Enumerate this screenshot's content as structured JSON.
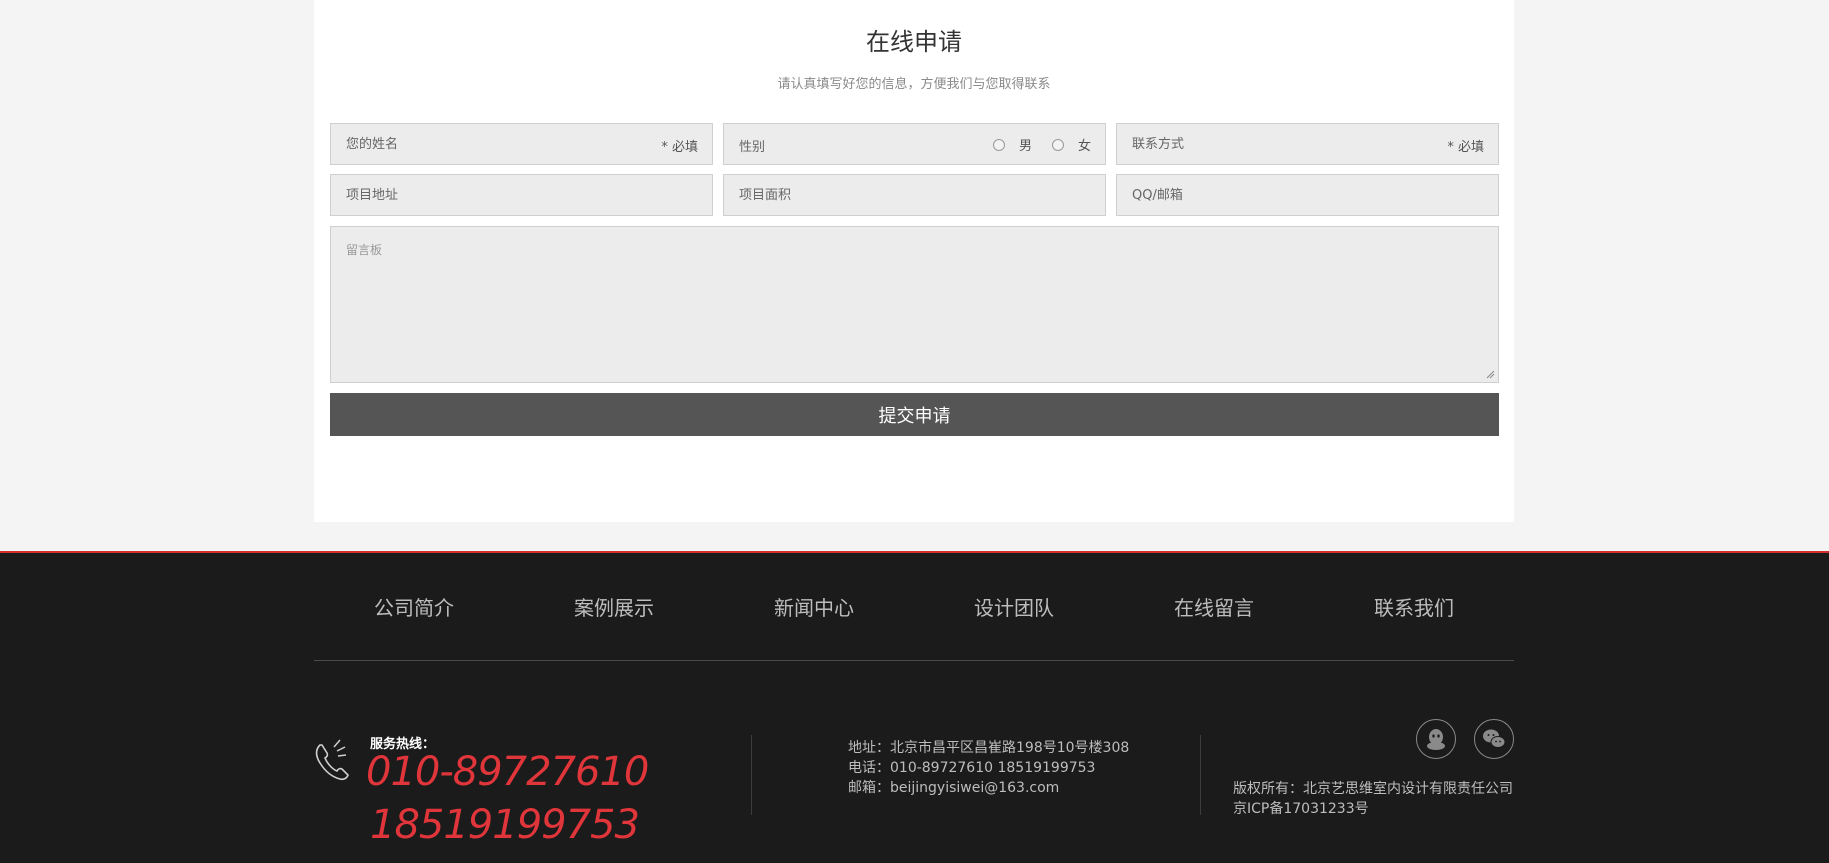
{
  "form": {
    "title": "在线申请",
    "subtitle": "请认真填写好您的信息，方便我们与您取得联系",
    "name_placeholder": "您的姓名",
    "required_label": "* 必填",
    "gender_label": "性别",
    "gender_male": "男",
    "gender_female": "女",
    "contact_placeholder": "联系方式",
    "address_placeholder": "项目地址",
    "area_placeholder": "项目面积",
    "qq_email_placeholder": "QQ/邮箱",
    "message_placeholder": "留言板",
    "submit_label": "提交申请"
  },
  "footer": {
    "nav": [
      "公司简介",
      "案例展示",
      "新闻中心",
      "设计团队",
      "在线留言",
      "联系我们"
    ],
    "hotline_label": "服务热线：",
    "hotline_1": "010-89727610",
    "hotline_2": "18519199753",
    "address": "地址：北京市昌平区昌崔路198号10号楼308",
    "phone": "电话：010-89727610 18519199753",
    "email": "邮箱：beijingyisiwei@163.com",
    "copyright": "版权所有：北京艺思维室内设计有限责任公司",
    "icp": "京ICP备17031233号",
    "social_icons": [
      "qq-icon",
      "wechat-icon"
    ]
  },
  "colors": {
    "accent_red": "#e0353a",
    "footer_bg": "#1b1b1b",
    "submit_bg": "#555555"
  }
}
